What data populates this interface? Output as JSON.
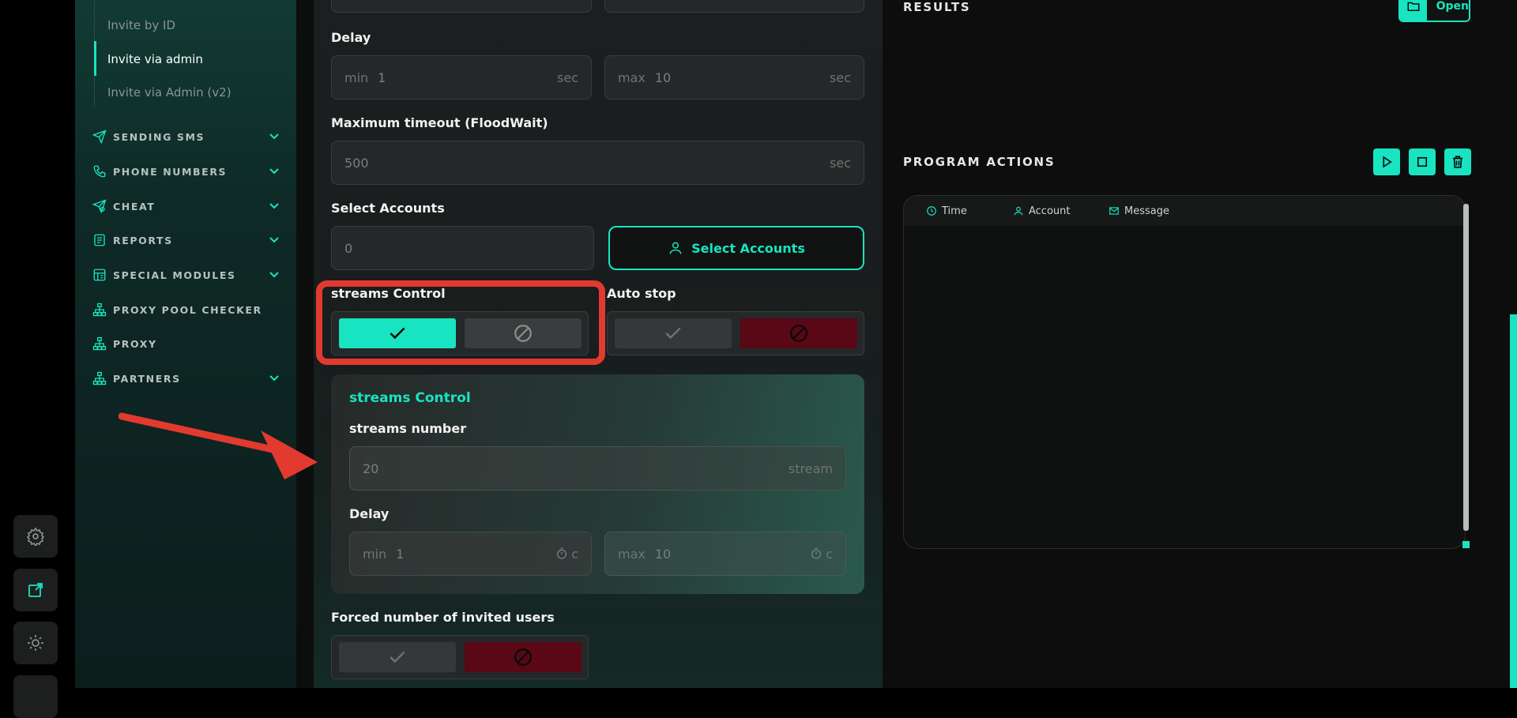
{
  "sidebar": {
    "sub_items": [
      "Invite by ID",
      "Invite via admin",
      "Invite via Admin (v2)"
    ],
    "nav": [
      {
        "label": "SENDING SMS",
        "icon": "send-icon",
        "expandable": true
      },
      {
        "label": "PHONE NUMBERS",
        "icon": "phone-icon",
        "expandable": true
      },
      {
        "label": "CHEAT",
        "icon": "cheat-send-icon",
        "expandable": true
      },
      {
        "label": "REPORTS",
        "icon": "report-icon",
        "expandable": true
      },
      {
        "label": "SPECIAL MODULES",
        "icon": "modules-icon",
        "expandable": true
      },
      {
        "label": "PROXY POOL CHECKER",
        "icon": "network-icon",
        "expandable": false
      },
      {
        "label": "PROXY",
        "icon": "network-icon",
        "expandable": false
      },
      {
        "label": "PARTNERS",
        "icon": "network-icon",
        "expandable": true
      }
    ]
  },
  "rail": {
    "icons": [
      "gear-icon",
      "external-link-icon",
      "sun-icon"
    ]
  },
  "form": {
    "delay": {
      "label": "Delay",
      "min_prefix": "min",
      "min_value": "1",
      "min_suffix": "sec",
      "max_prefix": "max",
      "max_value": "10",
      "max_suffix": "sec"
    },
    "timeout": {
      "label": "Maximum timeout (FloodWait)",
      "value": "500",
      "suffix": "sec"
    },
    "accounts": {
      "label": "Select Accounts",
      "value": "0",
      "button": "Select Accounts"
    },
    "streams_toggle": {
      "label": "streams Control",
      "state": "on"
    },
    "auto_stop": {
      "label": "Auto stop",
      "state": "off"
    },
    "streams_card": {
      "title": "streams Control",
      "number_label": "streams number",
      "number_value": "20",
      "number_suffix": "stream",
      "delay_label": "Delay",
      "min_prefix": "min",
      "min_value": "1",
      "min_suffix": "c",
      "max_prefix": "max",
      "max_value": "10",
      "max_suffix": "c"
    },
    "forced": {
      "label": "Forced number of invited users",
      "state": "off"
    }
  },
  "results": {
    "title": "RESULTS",
    "open_button": "Open"
  },
  "actions": {
    "title": "PROGRAM ACTIONS",
    "columns": [
      "Time",
      "Account",
      "Message"
    ]
  },
  "colors": {
    "accent": "#18e4c1",
    "danger": "#5a0716",
    "highlight_box": "#e23a2f"
  }
}
